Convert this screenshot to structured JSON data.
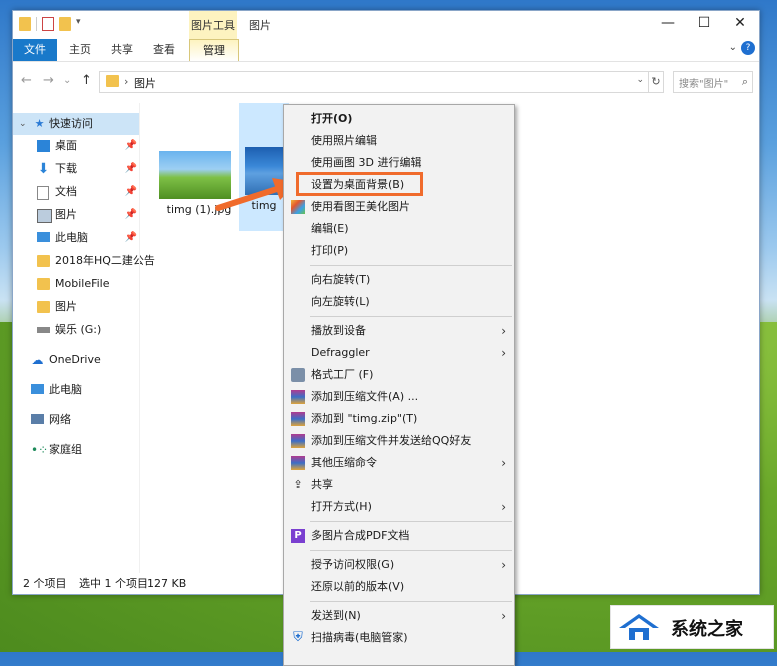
{
  "window": {
    "title": "图片",
    "picture_tools_label": "图片工具",
    "minimize": "—",
    "maximize": "☐",
    "close": "✕"
  },
  "ribbon": {
    "file": "文件",
    "tabs": [
      "主页",
      "共享",
      "查看"
    ],
    "manage": "管理",
    "help": "?"
  },
  "address_bar": {
    "back": "←",
    "forward": "→",
    "recent": "⌄",
    "up": "↑",
    "separator": "›",
    "path": "图片",
    "refresh": "↻",
    "search_placeholder": "搜索\"图片\""
  },
  "nav": {
    "quick_access": "快速访问",
    "items": [
      {
        "label": "桌面",
        "pinned": true
      },
      {
        "label": "下载",
        "pinned": true
      },
      {
        "label": "文档",
        "pinned": true
      },
      {
        "label": "图片",
        "pinned": true
      },
      {
        "label": "此电脑",
        "pinned": true
      },
      {
        "label": "2018年HQ二建公告",
        "pinned": false
      },
      {
        "label": "MobileFile",
        "pinned": false
      },
      {
        "label": "图片",
        "pinned": false
      },
      {
        "label": "娱乐 (G:)",
        "pinned": false
      }
    ],
    "onedrive": "OneDrive",
    "this_pc": "此电脑",
    "network": "网络",
    "homegroup": "家庭组"
  },
  "files": [
    {
      "name": "timg (1).jpg",
      "selected": false
    },
    {
      "name": "timg",
      "selected": true
    }
  ],
  "status": {
    "count": "2 个项目",
    "selected": "选中 1 个项目",
    "size": "127 KB"
  },
  "context_menu": {
    "groups": [
      [
        {
          "label": "打开(O)",
          "bold": true
        },
        {
          "label": "使用照片编辑"
        },
        {
          "label": "使用画图 3D 进行编辑"
        },
        {
          "label": "设置为桌面背景(B)",
          "highlighted": true
        },
        {
          "label": "使用看图王美化图片",
          "icon": "image-beautify-icon"
        },
        {
          "label": "编辑(E)"
        },
        {
          "label": "打印(P)"
        }
      ],
      [
        {
          "label": "向右旋转(T)"
        },
        {
          "label": "向左旋转(L)"
        }
      ],
      [
        {
          "label": "播放到设备",
          "submenu": true
        },
        {
          "label": "Defraggler",
          "submenu": true
        },
        {
          "label": "格式工厂 (F)",
          "icon": "format-factory-icon"
        },
        {
          "label": "添加到压缩文件(A) ...",
          "icon": "winrar-icon"
        },
        {
          "label": "添加到 \"timg.zip\"(T)",
          "icon": "winrar-icon"
        },
        {
          "label": "添加到压缩文件并发送给QQ好友",
          "icon": "winrar-icon"
        },
        {
          "label": "其他压缩命令",
          "icon": "winrar-icon",
          "submenu": true
        },
        {
          "label": "共享",
          "icon": "share-icon"
        },
        {
          "label": "打开方式(H)",
          "submenu": true
        }
      ],
      [
        {
          "label": "多图片合成PDF文档",
          "icon": "pdf-icon"
        }
      ],
      [
        {
          "label": "授予访问权限(G)",
          "submenu": true
        },
        {
          "label": "还原以前的版本(V)"
        }
      ],
      [
        {
          "label": "发送到(N)",
          "submenu": true
        },
        {
          "label": "扫描病毒(电脑管家)",
          "icon": "shield-icon"
        }
      ]
    ],
    "submenu_glyph": "›"
  },
  "watermark": {
    "text": "系统之家"
  },
  "colors": {
    "accent": "#1979ca",
    "highlight_box": "#f06b2c",
    "selection": "#cce8ff"
  }
}
